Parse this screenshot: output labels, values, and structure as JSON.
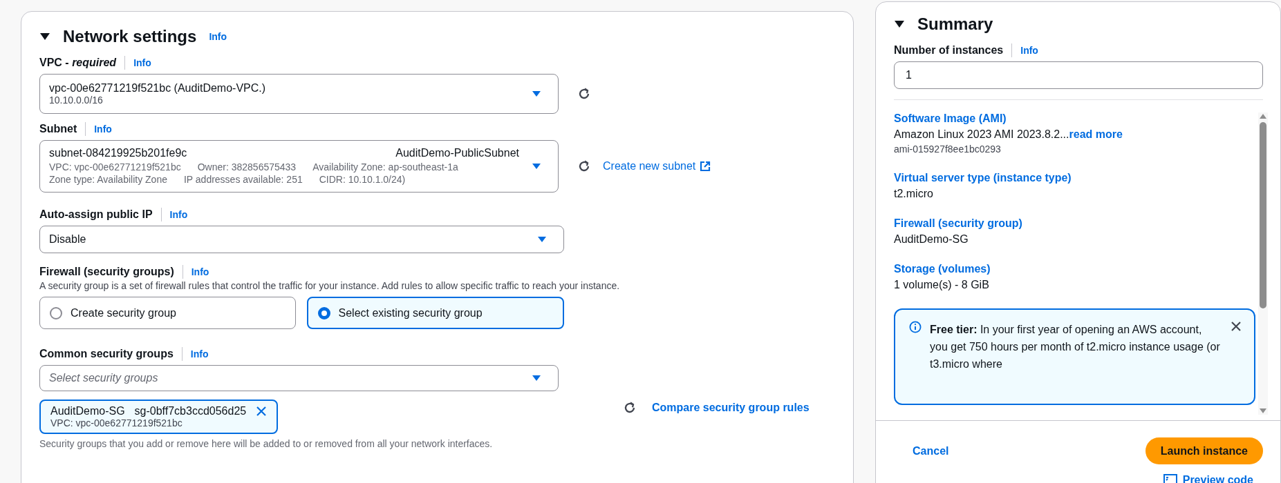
{
  "network_settings": {
    "title": "Network settings",
    "expanded": true,
    "info": "Info",
    "vpc": {
      "label": "VPC - *required*",
      "info": "Info",
      "value": "vpc-00e62771219f521bc (AuditDemo-VPC.)",
      "detail": "10.10.0.0/16"
    },
    "subnet": {
      "label": "Subnet",
      "info": "Info",
      "value": "subnet-084219925b201fe9c",
      "name": "AuditDemo-PublicSubnet",
      "detail_rows": [
        [
          "VPC: vpc-00e62771219f521bc",
          "Owner: 382856575433",
          "Availability Zone: ap-southeast-1a"
        ],
        [
          "Zone type: Availability Zone",
          "IP addresses available: 251",
          "CIDR: 10.10.1.0/24)"
        ]
      ],
      "link": "Create new subnet"
    },
    "auto_assign_public_ip": {
      "label": "Auto-assign public IP",
      "info": "Info",
      "value": "Disable"
    },
    "firewall": {
      "label": "Firewall (security groups)",
      "info": "Info",
      "description": "A security group is a set of firewall rules that control the traffic for your instance. Add rules to allow specific traffic to reach your instance.",
      "options": [
        {
          "label": "Create security group",
          "selected": false
        },
        {
          "label": "Select existing security group",
          "selected": true
        }
      ]
    },
    "common_security_groups": {
      "label": "Common security groups",
      "info": "Info",
      "placeholder": "Select security groups",
      "tokens": [
        {
          "name": "AuditDemo-SG",
          "id": "sg-0bff7cb3ccd056d25",
          "detail": "VPC: vpc-00e62771219f521bc"
        }
      ],
      "link": "Compare security group rules",
      "help": "Security groups that you add or remove here will be added to or removed from all your network interfaces."
    }
  },
  "summary": {
    "title": "Summary",
    "expanded": true,
    "instances": {
      "label": "Number of instances",
      "info": "Info",
      "value": "1"
    },
    "items": [
      {
        "title": "Software Image (AMI)",
        "value": "Amazon Linux 2023 AMI 2023.8.2...",
        "link": "read more",
        "detail": "ami-015927f8ee1bc0293"
      },
      {
        "title": "Virtual server type (instance type)",
        "value": "t2.micro"
      },
      {
        "title": "Firewall (security group)",
        "value": "AuditDemo-SG"
      },
      {
        "title": "Storage (volumes)",
        "value": "1 volume(s) - 8 GiB"
      }
    ],
    "alert": {
      "kind": "info",
      "text": "**Free tier:** In your first year of opening an AWS account, you get 750 hours per month of t2.micro instance usage (or t3.micro where"
    },
    "cancel": "Cancel",
    "launch": "Launch instance",
    "preview": "Preview code"
  }
}
